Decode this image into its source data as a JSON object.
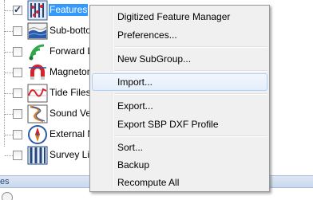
{
  "tree": {
    "items": [
      {
        "label": "Features",
        "checked": true,
        "selected": true,
        "icon": "features-grid-icon"
      },
      {
        "label": "Sub-botto",
        "checked": false,
        "selected": false,
        "icon": "sub-bottom-profile-icon"
      },
      {
        "label": "Forward L",
        "checked": false,
        "selected": false,
        "icon": "forward-looking-sonar-icon"
      },
      {
        "label": "Magnetom",
        "checked": false,
        "selected": false,
        "icon": "magnetometer-icon"
      },
      {
        "label": "Tide Files",
        "checked": false,
        "selected": false,
        "icon": "tide-files-icon"
      },
      {
        "label": "Sound Velo",
        "checked": false,
        "selected": false,
        "icon": "sound-velocity-icon"
      },
      {
        "label": "External N",
        "checked": false,
        "selected": false,
        "icon": "external-navigation-icon"
      },
      {
        "label": "Survey Lin",
        "checked": false,
        "selected": false,
        "icon": "survey-lines-icon"
      }
    ]
  },
  "bottom_strip": {
    "text": "es"
  },
  "context_menu": {
    "items": [
      {
        "label": "Digitized Feature Manager"
      },
      {
        "label": "Preferences..."
      },
      {
        "label": "New SubGroup..."
      },
      {
        "label": "Import..."
      },
      {
        "label": "Export..."
      },
      {
        "label": "Export SBP DXF Profile"
      },
      {
        "label": "Sort..."
      },
      {
        "label": "Backup"
      },
      {
        "label": "Recompute All"
      }
    ],
    "highlighted_item": "Import..."
  },
  "colors": {
    "selection": "#3399ff",
    "menu_background": "#f0f0f0",
    "menu_highlight_border": "#aecff7"
  }
}
